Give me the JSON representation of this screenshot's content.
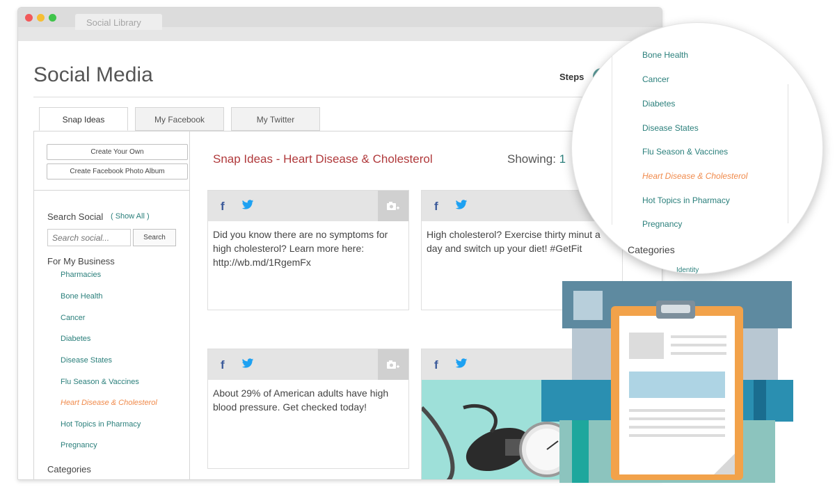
{
  "browser": {
    "tab_title": "Social Library"
  },
  "header": {
    "title": "Social Media",
    "steps_label": "Steps"
  },
  "tabs": [
    {
      "label": "Snap Ideas",
      "active": true
    },
    {
      "label": "My Facebook",
      "active": false
    },
    {
      "label": "My Twitter",
      "active": false
    }
  ],
  "sidebar": {
    "create_own": "Create Your Own",
    "create_album": "Create Facebook Photo Album",
    "search_heading": "Search Social",
    "show_all": "( Show All )",
    "search_placeholder": "Search social...",
    "search_button": "Search",
    "for_business": "For My Business",
    "items": [
      {
        "label": "Pharmacies",
        "active": false
      },
      {
        "label": "Bone Health",
        "active": false
      },
      {
        "label": "Cancer",
        "active": false
      },
      {
        "label": "Diabetes",
        "active": false
      },
      {
        "label": "Disease States",
        "active": false
      },
      {
        "label": "Flu Season & Vaccines",
        "active": false
      },
      {
        "label": "Heart Disease & Cholesterol",
        "active": true
      },
      {
        "label": "Hot Topics in Pharmacy",
        "active": false
      },
      {
        "label": "Pregnancy",
        "active": false
      }
    ],
    "categories": "Categories"
  },
  "main": {
    "title": "Snap Ideas - Heart Disease & Cholesterol",
    "showing_label": "Showing:",
    "showing_value": "1",
    "cards": [
      {
        "text": "Did you know there are no symptoms for high cholesterol? Learn more here: http://wb.md/1RgemFx"
      },
      {
        "text": "High cholesterol? Exercise thirty minut a day and switch up your diet! #GetFit"
      },
      {
        "text": "About 29% of American adults have high blood pressure. Get checked today!"
      },
      {
        "text": ""
      }
    ]
  },
  "magnifier": {
    "items": [
      {
        "label": "Bone Health",
        "active": false
      },
      {
        "label": "Cancer",
        "active": false
      },
      {
        "label": "Diabetes",
        "active": false
      },
      {
        "label": "Disease States",
        "active": false
      },
      {
        "label": "Flu Season & Vaccines",
        "active": false
      },
      {
        "label": "Heart Disease & Cholesterol",
        "active": true
      },
      {
        "label": "Hot Topics in Pharmacy",
        "active": false
      },
      {
        "label": "Pregnancy",
        "active": false
      }
    ],
    "categories": "Categories",
    "sub": "Identity"
  },
  "icons": {
    "facebook": "facebook-icon",
    "twitter": "twitter-icon",
    "camera": "add-photo-icon"
  },
  "colors": {
    "accent_teal": "#2a7f7b",
    "active_orange": "#f08a4b",
    "title_red": "#b0393b",
    "facebook_blue": "#3b5a9a",
    "twitter_blue": "#1da1f2"
  }
}
